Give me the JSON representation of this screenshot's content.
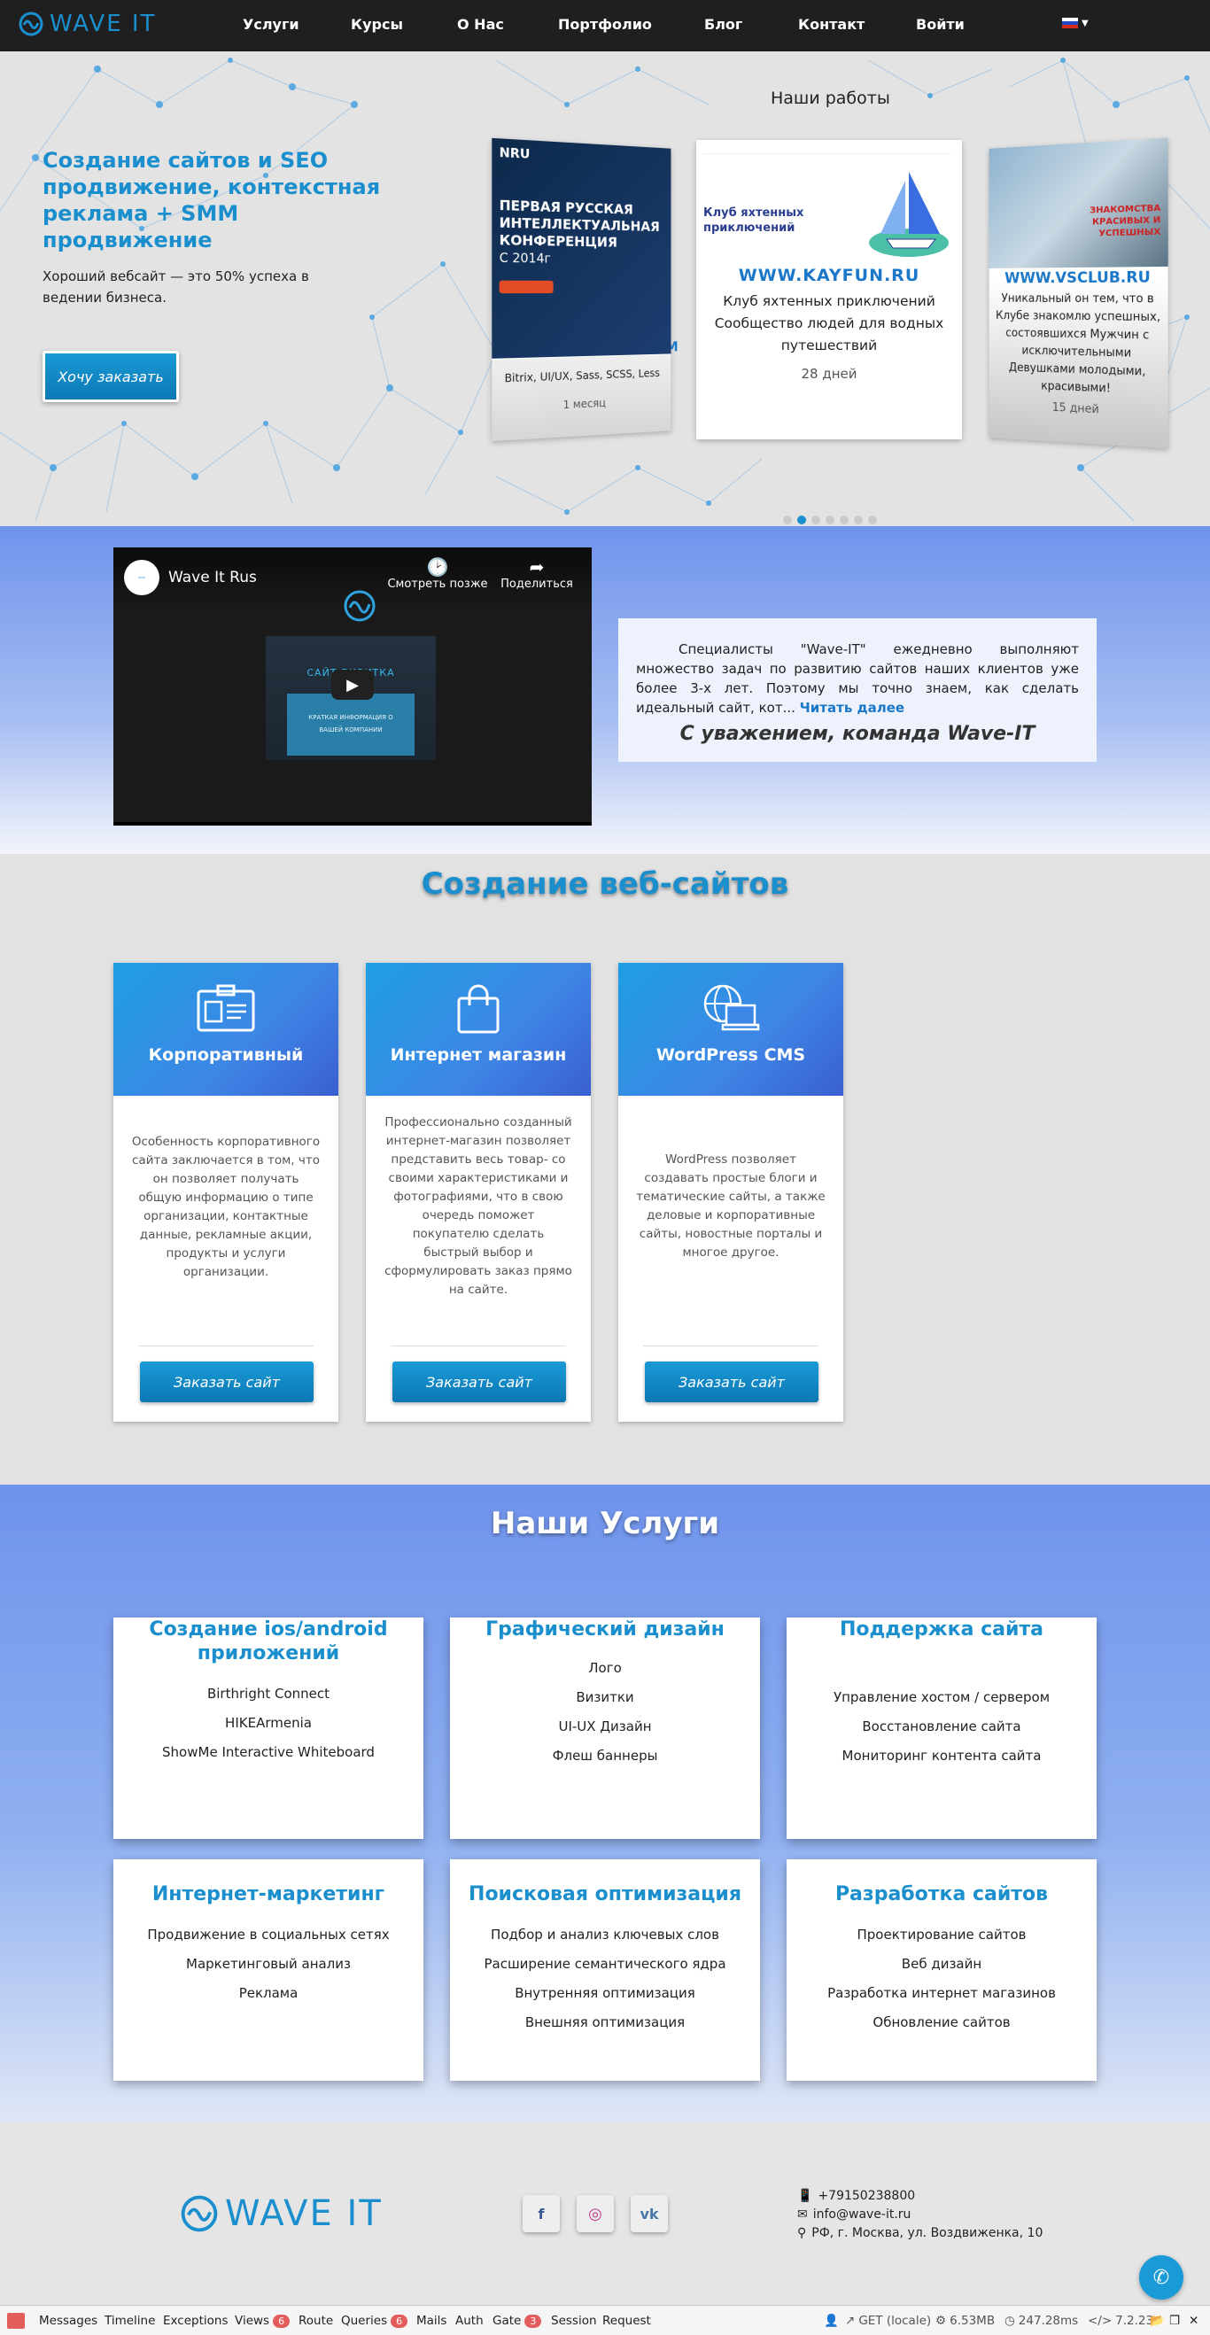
{
  "brand": {
    "logo_text": "WAVE IT",
    "accent": "#1b8fce"
  },
  "nav": {
    "items": [
      "Услуги",
      "Курсы",
      "О Нас",
      "Портфолио",
      "Блог",
      "Контакт",
      "Войти"
    ],
    "language_icon": "russian-flag-icon"
  },
  "hero": {
    "title": "Создание сайтов и SEO продвижение, контекстная реклама + SMM продвижение",
    "subtitle": "Хороший вебсайт — это 50% успеха в ведении бизнеса.",
    "cta": "Хочу заказать",
    "works_heading": "Наши работы",
    "works": [
      {
        "preview_title": "ПЕРВАЯ РУССКАЯ ИНТЕЛЛЕКТУАЛЬНАЯ КОНФЕРЕНЦИЯ",
        "preview_sub": "С 2014г",
        "preview_tag": "NRU",
        "site": "WWW.INRUONLINE.COM",
        "desc": "Bitrix, UI/UX, Sass, SCSS, Less",
        "duration": "1 месяц"
      },
      {
        "preview_title": "Клуб яхтенных приключений",
        "site": "WWW.KAYFUN.RU",
        "desc": "Клуб яхтенных приключений Сообщество людей для водных путешествий",
        "duration": "28 дней"
      },
      {
        "preview_title": "ЗНАКОМСТВА КРАСИВЫХ И УСПЕШНЫХ",
        "site": "WWW.VSCLUB.RU",
        "desc": "Уникальный он тем, что в Клубе знакомлю успешных, состоявшихся Мужчин с исключительными Девушками молодыми, красивыми!",
        "duration": "15 дней"
      }
    ],
    "active_slide": 2,
    "slide_count": 7
  },
  "video": {
    "channel": "Wave It Rus",
    "watch_later": "Смотреть позже",
    "share": "Поделиться",
    "thumb_title": "САЙТ-ВИЗИТКА",
    "thumb_text": "КРАТКАЯ ИНФОРМАЦИЯ О ВАШЕЙ КОМПАНИИ",
    "about_text": "Специалисты \"Wave-IT\" ежедневно выполняют множество задач по развитию сайтов наших клиентов уже более 3-х лет. Поэтому мы точно знаем, как сделать идеальный сайт, кот...",
    "read_more": "Читать далее",
    "signature": "С уважением, команда Wave-IT"
  },
  "websites": {
    "heading": "Создание веб-сайтов",
    "cards": [
      {
        "title": "Корпоративный",
        "icon": "id-card-icon",
        "text": "Особенность корпоративного сайта заключается в том, что он позволяет получать общую информацию о типе организации, контактные данные, рекламные акции, продукты и услуги организации.",
        "button": "Заказать сайт"
      },
      {
        "title": "Интернет магазин",
        "icon": "shopping-bag-icon",
        "text": "Профессионально созданный интернет-магазин позволяет представить весь товар- со своими характеристиками и фотографиями, что в свою очередь поможет покупателю сделать быстрый выбор и сформулировать заказ прямо на сайте.",
        "button": "Заказать сайт"
      },
      {
        "title": "WordPress CMS",
        "icon": "globe-laptop-icon",
        "text": "WordPress позволяет создавать простые блоги и тематические сайты, а также деловые и корпоративные сайты, новостные порталы и многое другое.",
        "button": "Заказать сайт"
      }
    ]
  },
  "services": {
    "heading": "Наши Услуги",
    "cards": [
      {
        "title": "Создание ios/android приложений",
        "items": [
          "Birthright Connect",
          "HIKEArmenia",
          "ShowMe Interactive Whiteboard"
        ]
      },
      {
        "title": "Графический дизайн",
        "items": [
          "Лого",
          "Визитки",
          "UI-UX Дизайн",
          "Флеш баннеры"
        ]
      },
      {
        "title": "Поддержка сайта",
        "items": [
          "Управление хостом / сервером",
          "Восстановление сайта",
          "Мониторинг контента сайта"
        ]
      },
      {
        "title": "Интернет-маркетинг",
        "items": [
          "Продвижение в социальных сетях",
          "Маркетинговый анализ",
          "Реклама"
        ]
      },
      {
        "title": "Поисковая оптимизация",
        "items": [
          "Подбор и анализ ключевых слов",
          "Расширение семантического ядра",
          "Внутренняя оптимизация",
          "Внешняя оптимизация"
        ]
      },
      {
        "title": "Разработка сайтов",
        "items": [
          "Проектирование сайтов",
          "Веб дизайн",
          "Разработка интернет магазинов",
          "Обновление сайтов"
        ]
      }
    ]
  },
  "footer": {
    "logo_text": "WAVE IT",
    "social": [
      {
        "icon": "facebook-icon",
        "glyph": "f"
      },
      {
        "icon": "instagram-icon",
        "glyph": "◎"
      },
      {
        "icon": "vk-icon",
        "glyph": "vk"
      }
    ],
    "phone": "+79150238800",
    "email": "info@wave-it.ru",
    "address": "РФ, г. Москва, ул. Воздвиженка, 10"
  },
  "debugbar": {
    "tabs": [
      {
        "label": "Messages"
      },
      {
        "label": "Timeline"
      },
      {
        "label": "Exceptions"
      },
      {
        "label": "Views",
        "badge": "6"
      },
      {
        "label": "Route"
      },
      {
        "label": "Queries",
        "badge": "6"
      },
      {
        "label": "Mails"
      },
      {
        "label": "Auth"
      },
      {
        "label": "Gate",
        "badge": "3"
      },
      {
        "label": "Session"
      },
      {
        "label": "Request"
      }
    ],
    "method": "GET (locale)",
    "memory": "6.53MB",
    "time": "247.28ms",
    "php": "7.2.23"
  }
}
